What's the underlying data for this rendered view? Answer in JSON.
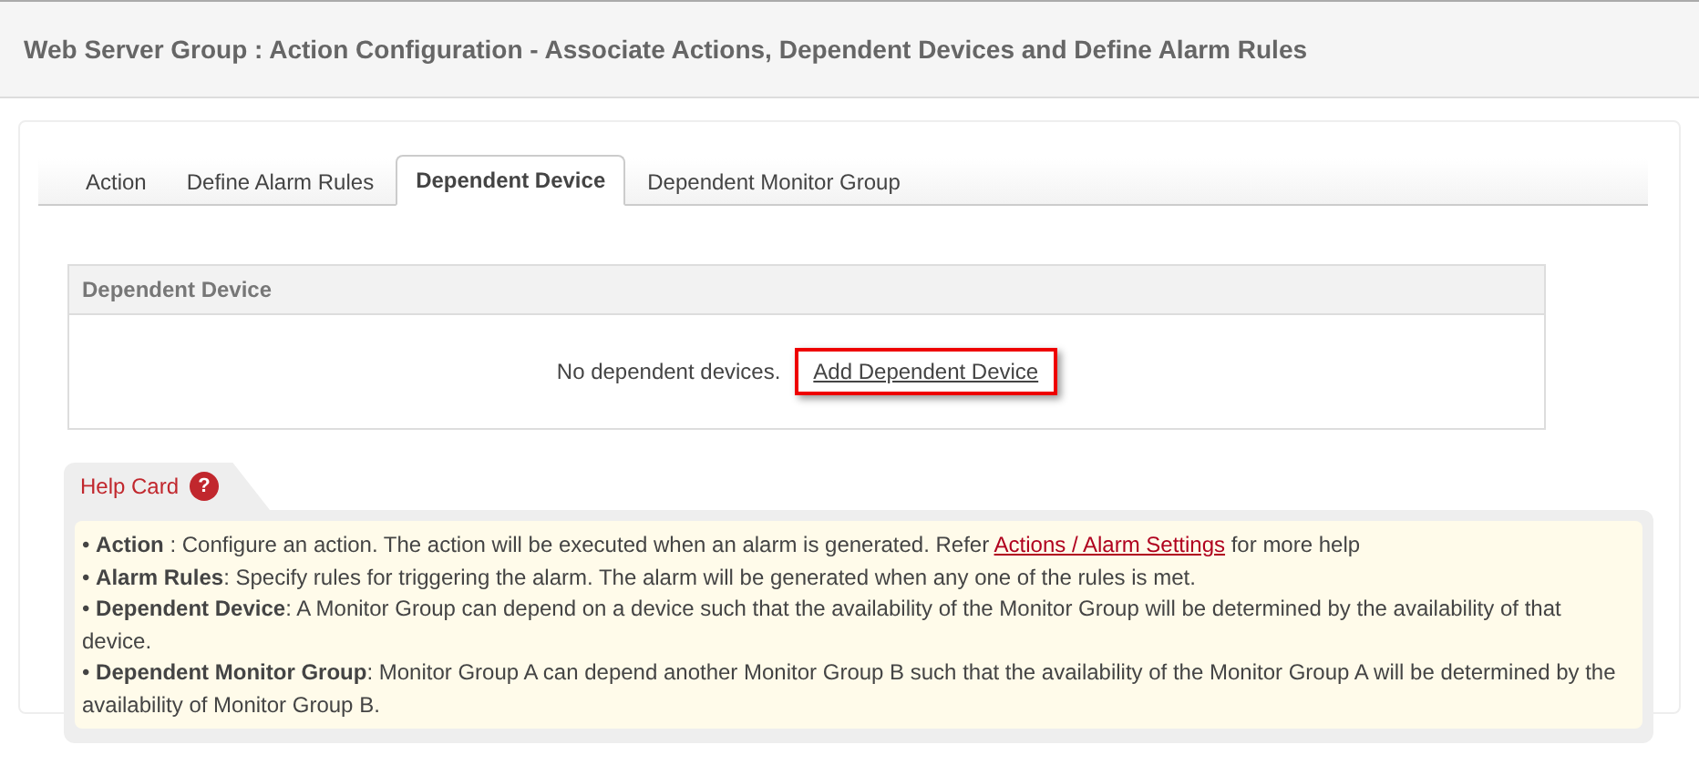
{
  "page_title": "Web Server Group : Action Configuration - Associate Actions, Dependent Devices and Define Alarm Rules",
  "tabs": [
    {
      "label": "Action",
      "selected": false
    },
    {
      "label": "Define Alarm Rules",
      "selected": false
    },
    {
      "label": "Dependent Device",
      "selected": true
    },
    {
      "label": "Dependent Monitor Group",
      "selected": false
    }
  ],
  "dependent_device_panel": {
    "title": "Dependent Device",
    "message": "No dependent devices.",
    "link": "Add Dependent Device"
  },
  "help_card": {
    "title": "Help Card",
    "icon": "?",
    "lines": [
      {
        "text": "• **Action** : Configure an action. The action will be executed when an alarm is generated. Refer ",
        "link": "Actions / Alarm Settings",
        "after": " for more help"
      },
      {
        "text": "• **Alarm Rules**: Specify rules for triggering the alarm. The alarm will be generated when any one of the rules is met."
      },
      {
        "text": "• **Dependent Device**: A Monitor Group can depend on a device such that the availability of the Monitor Group will be determined by the availability of that device."
      },
      {
        "text": "• **Dependent Monitor Group**: Monitor Group A can depend another Monitor Group B such that the availability of the Monitor Group A will be determined by the availability of Monitor Group B."
      }
    ]
  }
}
